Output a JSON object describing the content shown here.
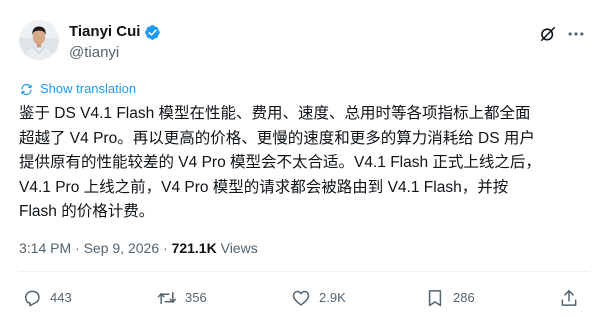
{
  "author": {
    "display_name": "Tianyi Cui",
    "handle": "@tianyi",
    "verified": true,
    "avatar": "avatar-photo"
  },
  "header_icons": [
    "grok-icon",
    "more-icon"
  ],
  "translation": {
    "label": "Show translation",
    "icon": "translate-icon"
  },
  "tweet": {
    "lines": [
      "鉴于 DS V4.1 Flash 模型在性能、费用、速度、总用时等各项指标上都全面",
      "超越了 V4 Pro。再以更高的价格、更慢的速度和更多的算力消耗给 DS 用户",
      "提供原有的性能较差的 V4 Pro 模型会不太合适。V4.1 Flash 正式上线之后，",
      "V4.1 Pro 上线之前，V4 Pro 模型的请求都会被路由到 V4.1 Flash，并按",
      "Flash 的价格计费。"
    ]
  },
  "meta": {
    "time": "3:14 PM",
    "separator": " · ",
    "date": "Sep 9, 2026",
    "views_count": "721.1K",
    "views_label": " Views"
  },
  "actions": {
    "reply": {
      "icon": "reply-icon",
      "count": "443"
    },
    "repost": {
      "icon": "repost-icon",
      "count": "356"
    },
    "like": {
      "icon": "heart-icon",
      "count": "2.9K"
    },
    "bookmark": {
      "icon": "bookmark-icon",
      "count": "286"
    },
    "share": {
      "icon": "share-icon"
    }
  },
  "colors": {
    "text": "#0f1419",
    "secondary": "#536471",
    "accent": "#1d9bf0",
    "divider": "#eff3f4"
  }
}
